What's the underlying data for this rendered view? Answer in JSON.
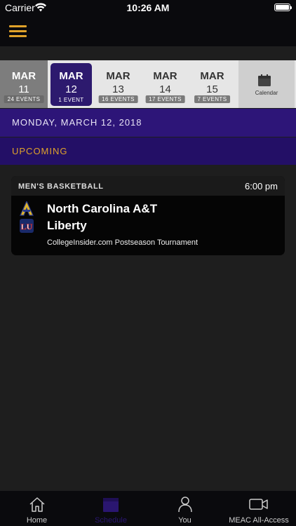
{
  "status_bar": {
    "carrier": "Carrier",
    "time": "10:26 AM"
  },
  "nav": {
    "menu_icon": "hamburger-menu-icon"
  },
  "date_strip": {
    "dates": [
      {
        "month": "MAR",
        "day": "11",
        "events": "24 EVENTS"
      },
      {
        "month": "MAR",
        "day": "12",
        "events": "1 EVENT"
      },
      {
        "month": "MAR",
        "day": "13",
        "events": "16 EVENTS"
      },
      {
        "month": "MAR",
        "day": "14",
        "events": "17 EVENTS"
      },
      {
        "month": "MAR",
        "day": "15",
        "events": "7 EVENTS"
      }
    ],
    "selected_index": 1,
    "calendar_label": "Calendar"
  },
  "schedule": {
    "date_heading": "MONDAY, MARCH 12, 2018",
    "section_heading": "UPCOMING"
  },
  "event": {
    "sport": "MEN'S BASKETBALL",
    "time": "6:00 pm",
    "team1": "North Carolina A&T",
    "team2": "Liberty",
    "tournament": "CollegeInsider.com Postseason Tournament"
  },
  "tab_bar": {
    "tabs": [
      {
        "label": "Home",
        "icon": "home-icon"
      },
      {
        "label": "Schedule",
        "icon": "calendar-icon"
      },
      {
        "label": "You",
        "icon": "person-icon"
      },
      {
        "label": "MEAC All-Access",
        "icon": "video-camera-icon"
      }
    ],
    "active_index": 1
  },
  "colors": {
    "accent_gold": "#e0a22a",
    "purple_primary": "#2d1578",
    "purple_dark": "#230f66",
    "selected_date": "#2d1a6e"
  }
}
